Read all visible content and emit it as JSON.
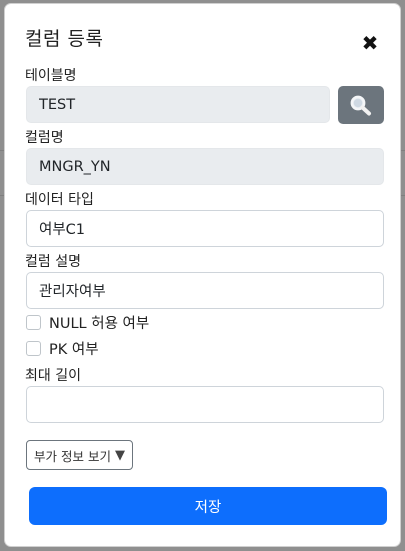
{
  "modal": {
    "title": "컬럼 등록",
    "close_icon": "close-icon"
  },
  "form": {
    "table_name": {
      "label": "테이블명",
      "value": "TEST"
    },
    "column_name": {
      "label": "컬럼명",
      "value": "MNGR_YN"
    },
    "data_type": {
      "label": "데이터 타입",
      "value": "여부C1"
    },
    "column_desc": {
      "label": "컬럼 설명",
      "value": "관리자여부"
    },
    "nullable": {
      "label": "NULL 허용 여부",
      "checked": false
    },
    "primary_key": {
      "label": "PK 여부",
      "checked": false
    },
    "max_length": {
      "label": "최대 길이",
      "value": ""
    }
  },
  "buttons": {
    "search_icon": "search-icon",
    "more_info_label": "부가 정보 보기",
    "more_info_arrow": "▼",
    "save_label": "저장"
  },
  "colors": {
    "primary": "#0d6efd",
    "secondary": "#6c757d",
    "readonly_bg": "#e9ecef"
  }
}
